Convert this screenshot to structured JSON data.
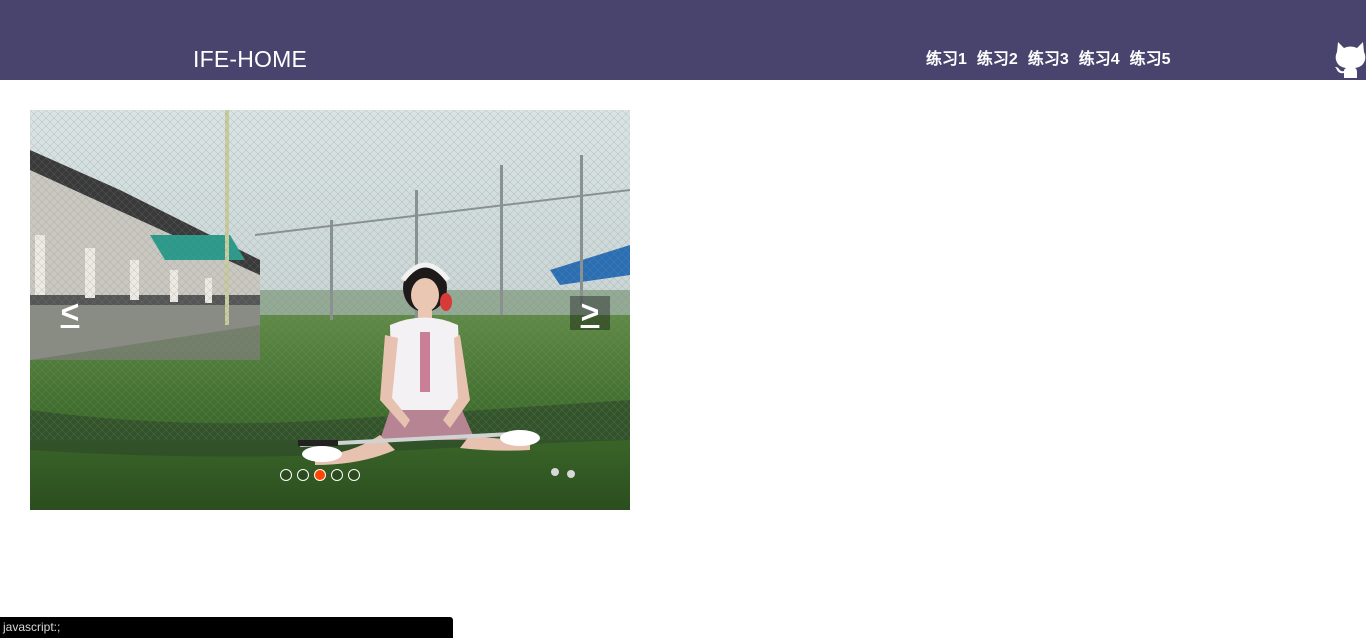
{
  "header": {
    "brand": "IFE-HOME",
    "nav": [
      {
        "label": "练习1"
      },
      {
        "label": "练习2"
      },
      {
        "label": "练习3"
      },
      {
        "label": "练习4"
      },
      {
        "label": "练习5"
      }
    ],
    "github_icon": "github-octocat-icon"
  },
  "slider": {
    "prev_label": "<",
    "next_label": ">",
    "dot_count": 5,
    "active_dot": 3,
    "image": "photo of a girl with headphones sitting on grass holding a golf club at a driving range"
  },
  "statusbar": {
    "text": "javascript:;"
  },
  "colors": {
    "header_bg": "#48446d",
    "active_dot": "#ff4500",
    "statusbar_bg": "#000000"
  }
}
